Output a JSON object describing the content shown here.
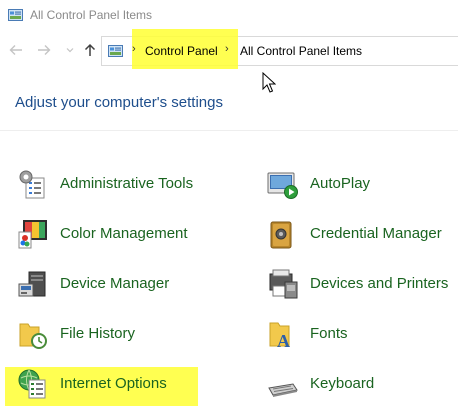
{
  "window": {
    "title": "All Control Panel Items"
  },
  "navigation": {
    "back_icon": "back-arrow-icon",
    "forward_icon": "forward-arrow-icon",
    "recent_icon": "chevron-down-icon",
    "up_icon": "up-arrow-icon"
  },
  "breadcrumb": {
    "items": [
      "Control Panel",
      "All Control Panel Items"
    ],
    "highlighted": "Control Panel"
  },
  "heading": "Adjust your computer's settings",
  "items": [
    {
      "label": "Administrative Tools",
      "icon": "administrative-tools-icon"
    },
    {
      "label": "AutoPlay",
      "icon": "autoplay-icon"
    },
    {
      "label": "Color Management",
      "icon": "color-management-icon"
    },
    {
      "label": "Credential Manager",
      "icon": "credential-manager-icon"
    },
    {
      "label": "Device Manager",
      "icon": "device-manager-icon"
    },
    {
      "label": "Devices and Printers",
      "icon": "devices-and-printers-icon"
    },
    {
      "label": "File History",
      "icon": "file-history-icon"
    },
    {
      "label": "Fonts",
      "icon": "fonts-icon"
    },
    {
      "label": "Internet Options",
      "icon": "internet-options-icon",
      "highlighted": true
    },
    {
      "label": "Keyboard",
      "icon": "keyboard-icon"
    }
  ],
  "colors": {
    "link_green": "#1a6420",
    "heading_blue": "#1e4e8c",
    "highlight_yellow": "#ffff33"
  }
}
